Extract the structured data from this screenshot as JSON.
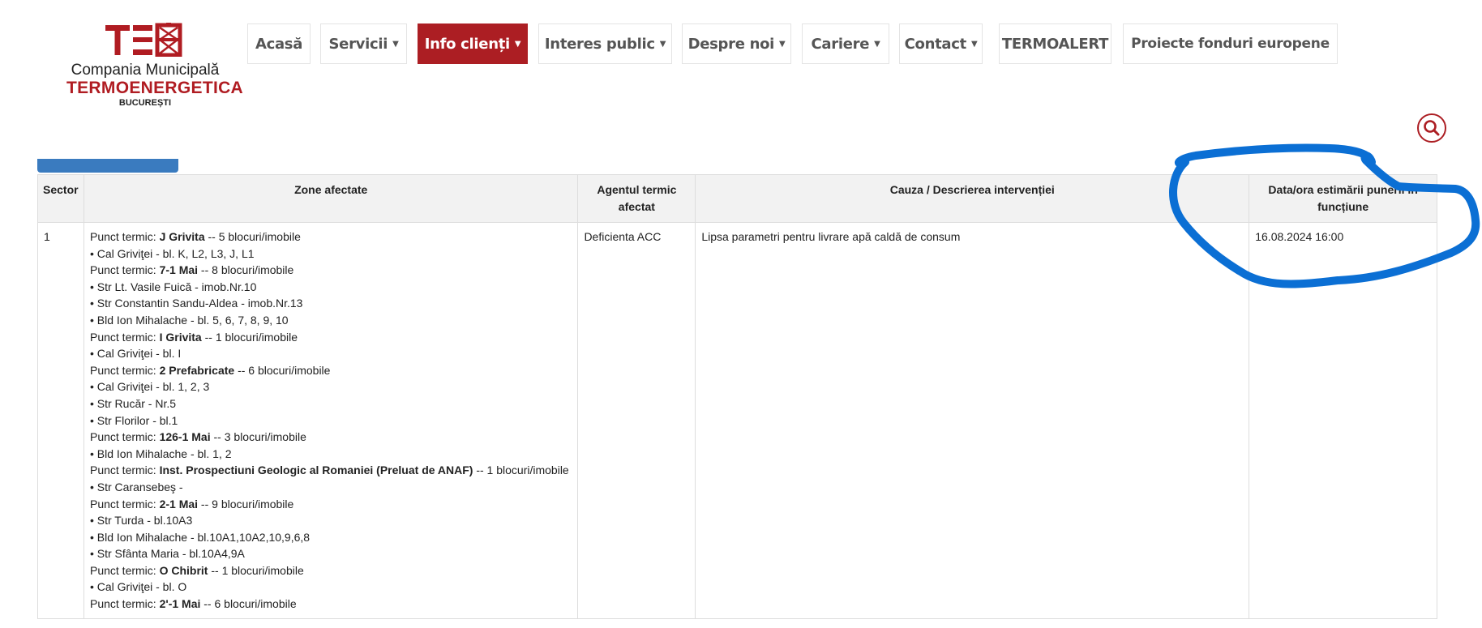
{
  "logo": {
    "mark": "TEB",
    "line1": "Compania Municipală",
    "line2": "TERMOENERGETICA",
    "line3": "BUCUREȘTI"
  },
  "nav": [
    {
      "label": "Acasă",
      "caret": false,
      "active": false
    },
    {
      "label": "Servicii",
      "caret": true,
      "active": false
    },
    {
      "label": "Info clienți",
      "caret": true,
      "active": true
    },
    {
      "label": "Interes public",
      "caret": true,
      "active": false
    },
    {
      "label": "Despre noi",
      "caret": true,
      "active": false
    },
    {
      "label": "Cariere",
      "caret": true,
      "active": false
    },
    {
      "label": "Contact",
      "caret": true,
      "active": false
    },
    {
      "label": "TERMOALERT",
      "caret": false,
      "active": false
    },
    {
      "label": "Proiecte fonduri europene",
      "caret": false,
      "active": false
    }
  ],
  "colors": {
    "brand": "#ac1e23",
    "accent_blue": "#3a7bbf",
    "annotation": "#0b6fd4"
  },
  "table": {
    "headers": {
      "sector": "Sector",
      "zone": "Zone afectate",
      "agent": "Agentul termic afectat",
      "cause": "Cauza / Descrierea intervenției",
      "date": "Data/ora estimării punerii în funcțiune"
    },
    "rows": [
      {
        "sector": "1",
        "agent": "Deficienta ACC",
        "cause": "Lipsa parametri pentru livrare apă caldă de consum",
        "date": "16.08.2024 16:00",
        "zone_lines": [
          {
            "pre": "Punct termic: ",
            "bold": "J Grivita",
            "post": " -- 5 blocuri/imobile"
          },
          {
            "pre": "• Cal Griviţei - bl. K, L2, L3, J, L1",
            "bold": "",
            "post": ""
          },
          {
            "pre": "Punct termic: ",
            "bold": "7-1 Mai",
            "post": " -- 8 blocuri/imobile"
          },
          {
            "pre": "• Str Lt. Vasile Fuică - imob.Nr.10",
            "bold": "",
            "post": ""
          },
          {
            "pre": "• Str Constantin Sandu-Aldea - imob.Nr.13",
            "bold": "",
            "post": ""
          },
          {
            "pre": "• Bld Ion Mihalache - bl. 5, 6, 7, 8, 9, 10",
            "bold": "",
            "post": ""
          },
          {
            "pre": "Punct termic: ",
            "bold": "I Grivita",
            "post": " -- 1 blocuri/imobile"
          },
          {
            "pre": "• Cal Griviţei - bl. I",
            "bold": "",
            "post": ""
          },
          {
            "pre": "Punct termic: ",
            "bold": "2 Prefabricate",
            "post": " -- 6 blocuri/imobile"
          },
          {
            "pre": "• Cal Griviţei - bl. 1, 2, 3",
            "bold": "",
            "post": ""
          },
          {
            "pre": "• Str Rucăr - Nr.5",
            "bold": "",
            "post": ""
          },
          {
            "pre": "• Str Florilor - bl.1",
            "bold": "",
            "post": ""
          },
          {
            "pre": "Punct termic: ",
            "bold": "126-1 Mai",
            "post": " -- 3 blocuri/imobile"
          },
          {
            "pre": "• Bld Ion Mihalache - bl. 1, 2",
            "bold": "",
            "post": ""
          },
          {
            "pre": "Punct termic: ",
            "bold": "Inst. Prospectiuni Geologic al Romaniei (Preluat de ANAF)",
            "post": " -- 1 blocuri/imobile",
            "justify": true
          },
          {
            "pre": "• Str Caransebeş -",
            "bold": "",
            "post": ""
          },
          {
            "pre": "Punct termic: ",
            "bold": "2-1 Mai",
            "post": " -- 9 blocuri/imobile"
          },
          {
            "pre": "• Str Turda - bl.10A3",
            "bold": "",
            "post": ""
          },
          {
            "pre": "• Bld Ion Mihalache - bl.10A1,10A2,10,9,6,8",
            "bold": "",
            "post": ""
          },
          {
            "pre": "• Str Sfânta Maria - bl.10A4,9A",
            "bold": "",
            "post": ""
          },
          {
            "pre": "Punct termic: ",
            "bold": "O Chibrit",
            "post": " -- 1 blocuri/imobile"
          },
          {
            "pre": "• Cal Griviţei - bl. O",
            "bold": "",
            "post": ""
          },
          {
            "pre": "Punct termic: ",
            "bold": "2'-1 Mai",
            "post": " -- 6 blocuri/imobile"
          }
        ]
      }
    ]
  }
}
